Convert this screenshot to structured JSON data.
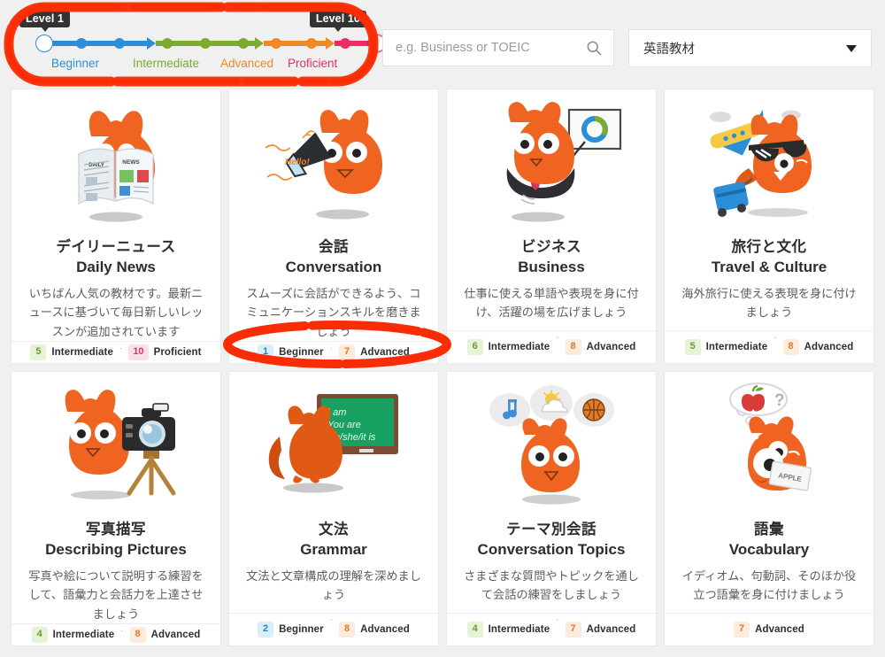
{
  "header": {
    "level_slider": {
      "tooltip_min": "Level 1",
      "tooltip_max": "Level 10",
      "min_value": 1,
      "max_value": 10,
      "bands": [
        {
          "label": "Beginner",
          "color": "#2b8fd8",
          "from": 1,
          "to": 3
        },
        {
          "label": "Intermediate",
          "color": "#7cab2f",
          "from": 4,
          "to": 6
        },
        {
          "label": "Advanced",
          "color": "#ef8827",
          "from": 7,
          "to": 8
        },
        {
          "label": "Proficient",
          "color": "#ef2b63",
          "from": 9,
          "to": 10
        }
      ]
    },
    "search": {
      "placeholder": "e.g. Business or TOEIC",
      "value": "",
      "icon": "search-icon"
    },
    "category_select": {
      "value": "英語教材",
      "icon": "chevron-down-icon"
    }
  },
  "cards": [
    {
      "id": "daily-news",
      "illustration": "owl-reading-newspaper",
      "title_ja": "デイリーニュース",
      "title_en": "Daily News",
      "description": "いちばん人気の教材です。最新ニュースに基づいて毎日新しいレッスンが追加されています",
      "levels": [
        {
          "number": "5",
          "name": "Intermediate",
          "band": "intermediate"
        },
        {
          "number": "10",
          "name": "Proficient",
          "band": "proficient"
        }
      ]
    },
    {
      "id": "conversation",
      "illustration": "owl-with-megaphone-hello",
      "title_ja": "会話",
      "title_en": "Conversation",
      "description": "スムーズに会話ができるよう、コミュニケーションスキルを磨きましょう",
      "levels": [
        {
          "number": "1",
          "name": "Beginner",
          "band": "beginner"
        },
        {
          "number": "7",
          "name": "Advanced",
          "band": "advanced"
        }
      ]
    },
    {
      "id": "business",
      "illustration": "owl-presenting-chart",
      "title_ja": "ビジネス",
      "title_en": "Business",
      "description": "仕事に使える単語や表現を身に付け、活躍の場を広げましょう",
      "levels": [
        {
          "number": "6",
          "name": "Intermediate",
          "band": "intermediate"
        },
        {
          "number": "8",
          "name": "Advanced",
          "band": "advanced"
        }
      ]
    },
    {
      "id": "travel-culture",
      "illustration": "owl-sunglasses-suitcase-airplane",
      "title_ja": "旅行と文化",
      "title_en": "Travel & Culture",
      "description": "海外旅行に使える表現を身に付けましょう",
      "levels": [
        {
          "number": "5",
          "name": "Intermediate",
          "band": "intermediate"
        },
        {
          "number": "8",
          "name": "Advanced",
          "band": "advanced"
        }
      ]
    },
    {
      "id": "describing-pictures",
      "illustration": "owl-with-camera-tripod",
      "title_ja": "写真描写",
      "title_en": "Describing Pictures",
      "description": "写真や絵について説明する練習をして、語彙力と会話力を上達させましょう",
      "levels": [
        {
          "number": "4",
          "name": "Intermediate",
          "band": "intermediate"
        },
        {
          "number": "8",
          "name": "Advanced",
          "band": "advanced"
        }
      ]
    },
    {
      "id": "grammar",
      "illustration": "owl-at-chalkboard",
      "title_ja": "文法",
      "title_en": "Grammar",
      "description": "文法と文章構成の理解を深めましょう",
      "chalkboard_text": [
        "I am",
        "You are",
        "He/she/it is"
      ],
      "levels": [
        {
          "number": "2",
          "name": "Beginner",
          "band": "beginner"
        },
        {
          "number": "8",
          "name": "Advanced",
          "band": "advanced"
        }
      ]
    },
    {
      "id": "conversation-topics",
      "illustration": "owl-with-thought-bubbles",
      "title_ja": "テーマ別会話",
      "title_en": "Conversation Topics",
      "description": "さまざまな質問やトピックを通して会話の練習をしましょう",
      "levels": [
        {
          "number": "4",
          "name": "Intermediate",
          "band": "intermediate"
        },
        {
          "number": "7",
          "name": "Advanced",
          "band": "advanced"
        }
      ]
    },
    {
      "id": "vocabulary",
      "illustration": "owl-thinking-apple-card",
      "title_ja": "語彙",
      "title_en": "Vocabulary",
      "description": "イディオム、句動詞、そのほか役立つ語彙を身に付けましょう",
      "card_label": "APPLE",
      "levels": [
        {
          "number": "7",
          "name": "Advanced",
          "band": "advanced"
        }
      ]
    }
  ],
  "annotations": [
    {
      "id": "highlight-level-slider",
      "shape": "rounded-rect",
      "color": "#f92d05"
    },
    {
      "id": "highlight-conversation-levels",
      "shape": "ellipse",
      "color": "#f92d05"
    }
  ]
}
